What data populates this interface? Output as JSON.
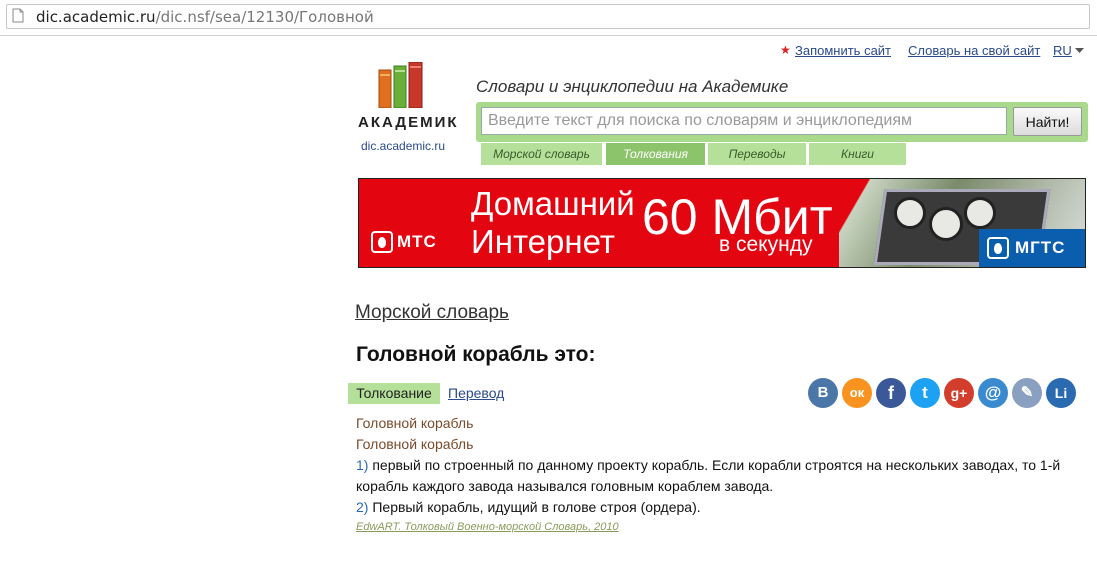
{
  "browser": {
    "url_domain": "dic.academic.ru",
    "url_path": "/dic.nsf/sea/12130/Головной"
  },
  "top_links": {
    "remember": "Запомнить сайт",
    "dictionary_on_site": "Словарь на свой сайт",
    "language": "RU"
  },
  "logo": {
    "name": "АКАДЕМИК",
    "site": "dic.academic.ru"
  },
  "tagline": "Словари и энциклопедии на Академике",
  "search": {
    "placeholder": "Введите текст для поиска по словарям и энциклопедиям",
    "button": "Найти!"
  },
  "tabs": [
    {
      "label": "Морской словарь",
      "active": false
    },
    {
      "label": "Толкования",
      "active": true
    },
    {
      "label": "Переводы",
      "active": false
    },
    {
      "label": "Книги",
      "active": false
    }
  ],
  "banner": {
    "brand_left": "МТС",
    "line1": "Домашний",
    "line2": "Интернет",
    "speed": "60 Мбит",
    "speed_sub": "в секунду",
    "brand_right": "МГТС",
    "colors": {
      "red": "#e30611",
      "blue": "#0b5eae"
    }
  },
  "content": {
    "dictionary": "Морской словарь",
    "entry_title": "Головной корабль это:",
    "view_tabs": {
      "interpretation": "Толкование",
      "translation": "Перевод"
    },
    "headword1": "Головной корабль",
    "headword2": "Головной корабль",
    "def1_num": "1)",
    "def1_line1": "первый по строенный по данному проекту корабль. Если корабли строятся на нескольких заводах, то 1-й",
    "def1_line2": "корабль каждого завода назывался головным кораблем завода.",
    "def2_num": "2)",
    "def2_text": "Первый корабль, идущий в голове строя (ордера).",
    "source": "EdwART. Толковый Военно-морской Словарь, 2010"
  },
  "share_buttons": [
    {
      "icon": "vk-icon",
      "glyph": "В",
      "color": "#4a76a8"
    },
    {
      "icon": "odnoklassniki-icon",
      "glyph": "ок",
      "color": "#f7931e"
    },
    {
      "icon": "facebook-icon",
      "glyph": "f",
      "color": "#3b5998"
    },
    {
      "icon": "twitter-icon",
      "glyph": "t",
      "color": "#1da1f2"
    },
    {
      "icon": "google-plus-icon",
      "glyph": "g+",
      "color": "#d23e2b"
    },
    {
      "icon": "email-icon",
      "glyph": "@",
      "color": "#3a8ad0"
    },
    {
      "icon": "livejournal-icon",
      "glyph": "✎",
      "color": "#8aa0c0"
    },
    {
      "icon": "liveinternet-icon",
      "glyph": "Li",
      "color": "#2a6ab0"
    }
  ]
}
